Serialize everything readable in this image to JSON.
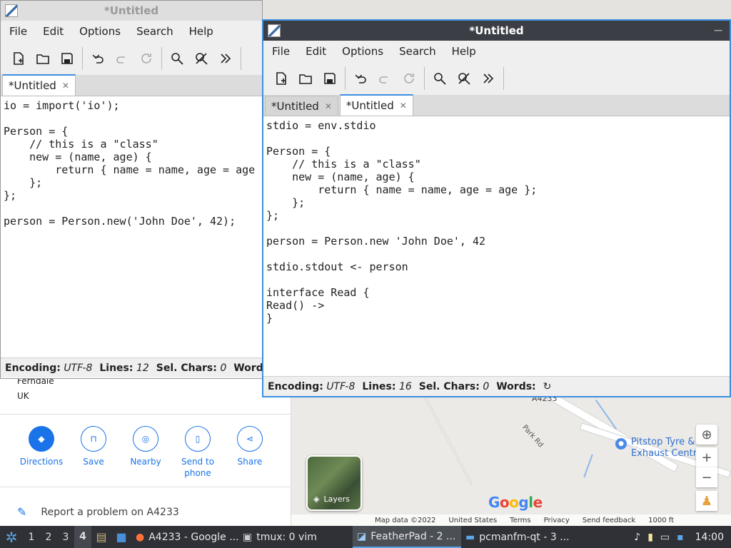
{
  "maps": {
    "address_lines": [
      "Ferndale",
      "UK"
    ],
    "actions": [
      {
        "label": "Directions",
        "icon": "directions-icon"
      },
      {
        "label": "Save",
        "icon": "bookmark-icon"
      },
      {
        "label": "Nearby",
        "icon": "nearby-icon"
      },
      {
        "label": "Send to phone",
        "icon": "phone-icon"
      },
      {
        "label": "Share",
        "icon": "share-icon"
      }
    ],
    "report": "Report a problem on A4233",
    "road_label": "A4233",
    "street_label": "Park Rd",
    "poi": "Pitstop Tyre & Exhaust Centre",
    "layers_label": "Layers",
    "logo": "Google",
    "attribution": [
      "Map data ©2022",
      "United States",
      "Terms",
      "Privacy",
      "Send feedback",
      "1000 ft"
    ]
  },
  "window_back": {
    "title": "*Untitled",
    "menu": [
      "File",
      "Edit",
      "Options",
      "Search",
      "Help"
    ],
    "tabs": [
      {
        "label": "*Untitled",
        "active": true
      }
    ],
    "code": "io = import('io');\n\nPerson = {\n    // this is a \"class\"\n    new = (name, age) {\n        return { name = name, age = age\n    };\n};\n\nperson = Person.new('John Doe', 42);",
    "status": {
      "encoding_label": "Encoding:",
      "encoding": "UTF-8",
      "lines_label": "Lines:",
      "lines": "12",
      "sel_label": "Sel. Chars:",
      "sel": "0",
      "words_label": "Words:"
    }
  },
  "window_front": {
    "title": "*Untitled",
    "menu": [
      "File",
      "Edit",
      "Options",
      "Search",
      "Help"
    ],
    "tabs": [
      {
        "label": "*Untitled",
        "active": false
      },
      {
        "label": "*Untitled",
        "active": true
      }
    ],
    "code": "stdio = env.stdio\n\nPerson = {\n    // this is a \"class\"\n    new = (name, age) {\n        return { name = name, age = age };\n    };\n};\n\nperson = Person.new 'John Doe', 42\n\nstdio.stdout <- person\n\ninterface Read {\nRead() ->\n}",
    "status": {
      "encoding_label": "Encoding:",
      "encoding": "UTF-8",
      "lines_label": "Lines:",
      "lines": "16",
      "sel_label": "Sel. Chars:",
      "sel": "0",
      "words_label": "Words:"
    }
  },
  "toolbar_icons": [
    "new-file-icon",
    "open-folder-icon",
    "save-icon",
    "undo-icon",
    "redo-icon",
    "reload-icon",
    "find-icon",
    "replace-icon",
    "more-icon"
  ],
  "taskbar": {
    "workspaces": [
      "1",
      "2",
      "3",
      "4"
    ],
    "active_workspace": "4",
    "tasks": [
      {
        "label": "A4233 - Google ...",
        "icon": "firefox-icon"
      },
      {
        "label": "tmux: 0 vim",
        "icon": "terminal-icon"
      },
      {
        "label": "FeatherPad - 2 ...",
        "icon": "featherpad-icon",
        "active": true
      },
      {
        "label": "pcmanfm-qt - 3 ...",
        "icon": "folder-icon"
      }
    ],
    "clock": "14:00"
  },
  "colors": {
    "accent": "#3d8ee0",
    "maps_blue": "#1a73e8",
    "titlebar_active": "#3b3f45",
    "taskbar": "#2f3136"
  }
}
